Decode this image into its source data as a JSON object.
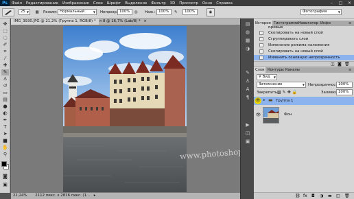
{
  "menubar": {
    "logo": "Ps",
    "items": [
      "Файл",
      "Редактирование",
      "Изображение",
      "Слои",
      "Шрифт",
      "Выделение",
      "Фильтр",
      "3D",
      "Просмотр",
      "Окно",
      "Справка"
    ],
    "controls": [
      "–",
      "□",
      "✕"
    ]
  },
  "options": {
    "brush_size": "25",
    "mode_label": "Режим:",
    "mode_value": "Нормальный",
    "opacity_label": "Непрозр.:",
    "opacity_value": "100%",
    "pressure_label": "Наж.:",
    "pressure_value": "100%",
    "flow_value": "100%",
    "workspace_value": "Фотография"
  },
  "documents": {
    "tabs": [
      {
        "label": "IMG_3930.JPG @ 21,2% (Группа 1, RGB/8) *",
        "close": "×"
      },
      {
        "label": "8 @ 16,7% (Lab/8) *",
        "close": "×"
      }
    ]
  },
  "status": {
    "zoom": "21,24%",
    "info": "2112 пикс. x 2816 пикс. (1..."
  },
  "watermark": "www.photoshopsunduchok.ru",
  "history_panel": {
    "tabs": [
      "История",
      "Гистограмма",
      "Навигатор",
      "Инфо"
    ],
    "items": [
      {
        "label": "Кривые",
        "selected": false
      },
      {
        "label": "Скопировать на новый слой",
        "selected": false
      },
      {
        "label": "Сгруппировать слои",
        "selected": false
      },
      {
        "label": "Изменение режима наложения",
        "selected": false
      },
      {
        "label": "Скопировать на новый слой",
        "selected": false
      },
      {
        "label": "Изменить основную непрозрачность",
        "selected": true
      }
    ]
  },
  "layers_panel": {
    "tabs": [
      "Слои",
      "Контуры",
      "Каналы"
    ],
    "filter_kind": "Вид",
    "blend_mode": "Затемнение",
    "opacity_label": "Непрозрачность:",
    "opacity_value": "100%",
    "lock_label": "Закрепить:",
    "fill_label": "Заливка:",
    "fill_value": "100%",
    "layers": [
      {
        "name": "Группа 1",
        "type": "group",
        "selected": true
      },
      {
        "name": "Фон",
        "type": "image",
        "selected": false
      }
    ]
  },
  "colors": {
    "accent_selection": "#8db3ee",
    "ps_logo_bg": "#001d34",
    "ps_logo_fg": "#31a8ff",
    "foreground": "#000000",
    "background": "#ffffff"
  },
  "icons": [
    "brush-preset-icon",
    "move-tool-icon",
    "marquee-tool-icon",
    "lasso-tool-icon",
    "quick-select-icon",
    "crop-tool-icon",
    "eyedropper-icon",
    "healing-brush-icon",
    "brush-tool-icon",
    "clone-stamp-icon",
    "history-brush-icon",
    "eraser-icon",
    "gradient-icon",
    "blur-icon",
    "dodge-icon",
    "pen-icon",
    "type-icon",
    "path-select-icon",
    "shape-icon",
    "hand-icon",
    "zoom-icon",
    "eye-icon",
    "folder-icon",
    "lock-icon"
  ]
}
